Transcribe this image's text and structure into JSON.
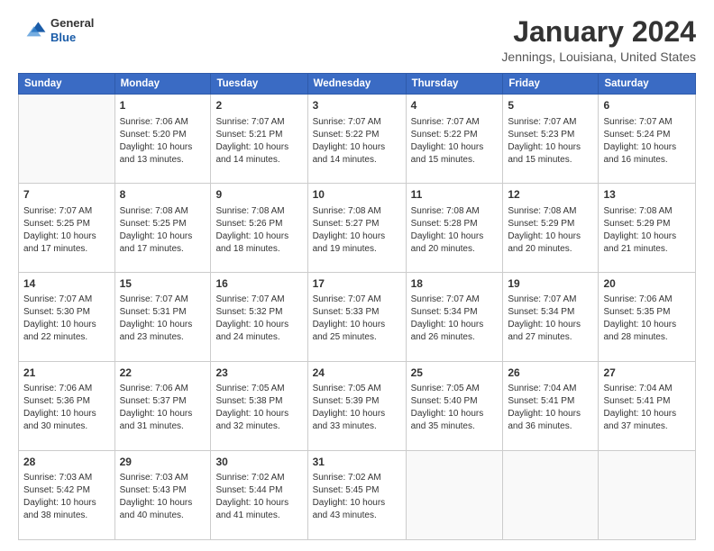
{
  "header": {
    "logo_general": "General",
    "logo_blue": "Blue",
    "title": "January 2024",
    "location": "Jennings, Louisiana, United States"
  },
  "days_of_week": [
    "Sunday",
    "Monday",
    "Tuesday",
    "Wednesday",
    "Thursday",
    "Friday",
    "Saturday"
  ],
  "weeks": [
    [
      {
        "day": "",
        "info": ""
      },
      {
        "day": "1",
        "info": "Sunrise: 7:06 AM\nSunset: 5:20 PM\nDaylight: 10 hours\nand 13 minutes."
      },
      {
        "day": "2",
        "info": "Sunrise: 7:07 AM\nSunset: 5:21 PM\nDaylight: 10 hours\nand 14 minutes."
      },
      {
        "day": "3",
        "info": "Sunrise: 7:07 AM\nSunset: 5:22 PM\nDaylight: 10 hours\nand 14 minutes."
      },
      {
        "day": "4",
        "info": "Sunrise: 7:07 AM\nSunset: 5:22 PM\nDaylight: 10 hours\nand 15 minutes."
      },
      {
        "day": "5",
        "info": "Sunrise: 7:07 AM\nSunset: 5:23 PM\nDaylight: 10 hours\nand 15 minutes."
      },
      {
        "day": "6",
        "info": "Sunrise: 7:07 AM\nSunset: 5:24 PM\nDaylight: 10 hours\nand 16 minutes."
      }
    ],
    [
      {
        "day": "7",
        "info": "Sunrise: 7:07 AM\nSunset: 5:25 PM\nDaylight: 10 hours\nand 17 minutes."
      },
      {
        "day": "8",
        "info": "Sunrise: 7:08 AM\nSunset: 5:25 PM\nDaylight: 10 hours\nand 17 minutes."
      },
      {
        "day": "9",
        "info": "Sunrise: 7:08 AM\nSunset: 5:26 PM\nDaylight: 10 hours\nand 18 minutes."
      },
      {
        "day": "10",
        "info": "Sunrise: 7:08 AM\nSunset: 5:27 PM\nDaylight: 10 hours\nand 19 minutes."
      },
      {
        "day": "11",
        "info": "Sunrise: 7:08 AM\nSunset: 5:28 PM\nDaylight: 10 hours\nand 20 minutes."
      },
      {
        "day": "12",
        "info": "Sunrise: 7:08 AM\nSunset: 5:29 PM\nDaylight: 10 hours\nand 20 minutes."
      },
      {
        "day": "13",
        "info": "Sunrise: 7:08 AM\nSunset: 5:29 PM\nDaylight: 10 hours\nand 21 minutes."
      }
    ],
    [
      {
        "day": "14",
        "info": "Sunrise: 7:07 AM\nSunset: 5:30 PM\nDaylight: 10 hours\nand 22 minutes."
      },
      {
        "day": "15",
        "info": "Sunrise: 7:07 AM\nSunset: 5:31 PM\nDaylight: 10 hours\nand 23 minutes."
      },
      {
        "day": "16",
        "info": "Sunrise: 7:07 AM\nSunset: 5:32 PM\nDaylight: 10 hours\nand 24 minutes."
      },
      {
        "day": "17",
        "info": "Sunrise: 7:07 AM\nSunset: 5:33 PM\nDaylight: 10 hours\nand 25 minutes."
      },
      {
        "day": "18",
        "info": "Sunrise: 7:07 AM\nSunset: 5:34 PM\nDaylight: 10 hours\nand 26 minutes."
      },
      {
        "day": "19",
        "info": "Sunrise: 7:07 AM\nSunset: 5:34 PM\nDaylight: 10 hours\nand 27 minutes."
      },
      {
        "day": "20",
        "info": "Sunrise: 7:06 AM\nSunset: 5:35 PM\nDaylight: 10 hours\nand 28 minutes."
      }
    ],
    [
      {
        "day": "21",
        "info": "Sunrise: 7:06 AM\nSunset: 5:36 PM\nDaylight: 10 hours\nand 30 minutes."
      },
      {
        "day": "22",
        "info": "Sunrise: 7:06 AM\nSunset: 5:37 PM\nDaylight: 10 hours\nand 31 minutes."
      },
      {
        "day": "23",
        "info": "Sunrise: 7:05 AM\nSunset: 5:38 PM\nDaylight: 10 hours\nand 32 minutes."
      },
      {
        "day": "24",
        "info": "Sunrise: 7:05 AM\nSunset: 5:39 PM\nDaylight: 10 hours\nand 33 minutes."
      },
      {
        "day": "25",
        "info": "Sunrise: 7:05 AM\nSunset: 5:40 PM\nDaylight: 10 hours\nand 35 minutes."
      },
      {
        "day": "26",
        "info": "Sunrise: 7:04 AM\nSunset: 5:41 PM\nDaylight: 10 hours\nand 36 minutes."
      },
      {
        "day": "27",
        "info": "Sunrise: 7:04 AM\nSunset: 5:41 PM\nDaylight: 10 hours\nand 37 minutes."
      }
    ],
    [
      {
        "day": "28",
        "info": "Sunrise: 7:03 AM\nSunset: 5:42 PM\nDaylight: 10 hours\nand 38 minutes."
      },
      {
        "day": "29",
        "info": "Sunrise: 7:03 AM\nSunset: 5:43 PM\nDaylight: 10 hours\nand 40 minutes."
      },
      {
        "day": "30",
        "info": "Sunrise: 7:02 AM\nSunset: 5:44 PM\nDaylight: 10 hours\nand 41 minutes."
      },
      {
        "day": "31",
        "info": "Sunrise: 7:02 AM\nSunset: 5:45 PM\nDaylight: 10 hours\nand 43 minutes."
      },
      {
        "day": "",
        "info": ""
      },
      {
        "day": "",
        "info": ""
      },
      {
        "day": "",
        "info": ""
      }
    ]
  ]
}
